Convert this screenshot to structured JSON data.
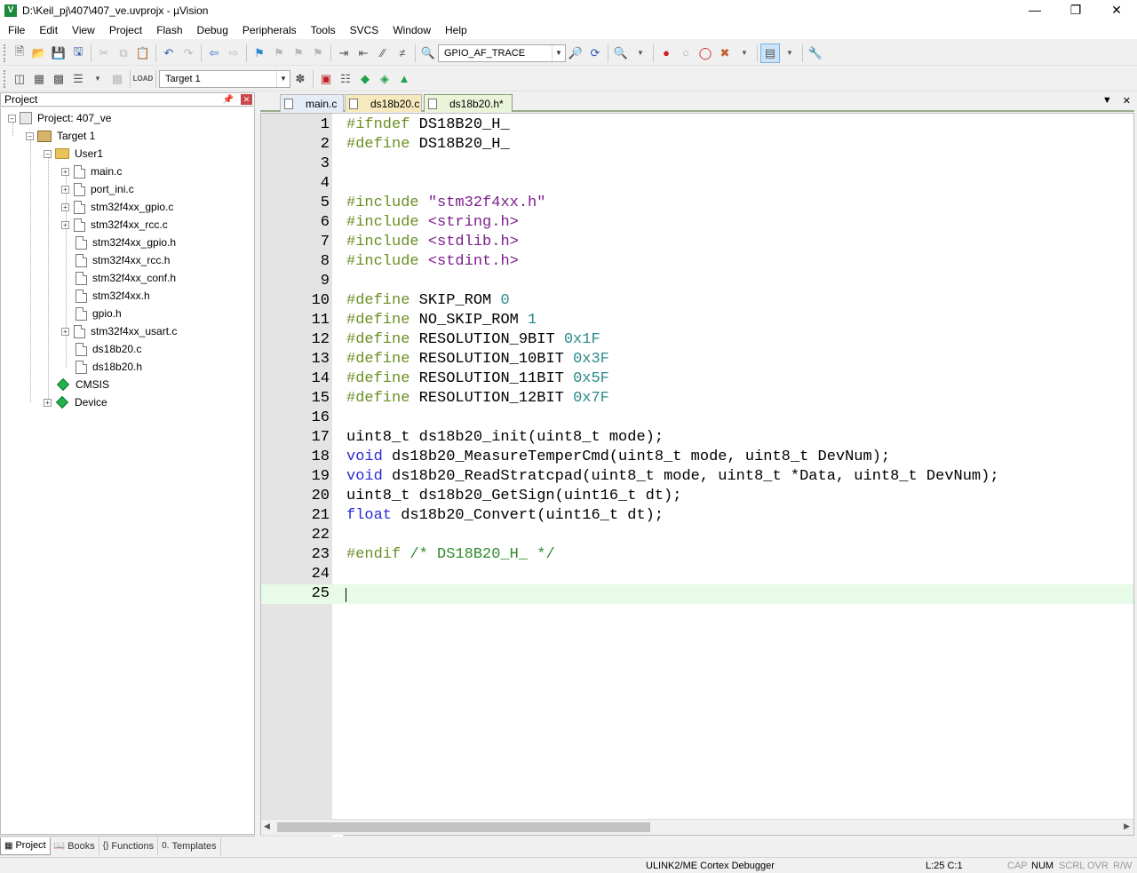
{
  "window": {
    "title": "D:\\Keil_pj\\407\\407_ve.uvprojx - µVision",
    "icon": "V"
  },
  "menu": [
    "File",
    "Edit",
    "View",
    "Project",
    "Flash",
    "Debug",
    "Peripherals",
    "Tools",
    "SVCS",
    "Window",
    "Help"
  ],
  "toolbar": {
    "function_combo": "GPIO_AF_TRACE",
    "target_combo": "Target 1"
  },
  "project_panel": {
    "title": "Project",
    "root": "Project: 407_ve",
    "target": "Target 1",
    "group": "User1",
    "files": [
      "main.c",
      "port_ini.c",
      "stm32f4xx_gpio.c",
      "stm32f4xx_rcc.c",
      "stm32f4xx_gpio.h",
      "stm32f4xx_rcc.h",
      "stm32f4xx_conf.h",
      "stm32f4xx.h",
      "gpio.h",
      "stm32f4xx_usart.c",
      "ds18b20.c",
      "ds18b20.h"
    ],
    "cmsis": "CMSIS",
    "device": "Device"
  },
  "bottom_tabs": [
    "Project",
    "Books",
    "Functions",
    "Templates"
  ],
  "editor_tabs": [
    "main.c",
    "ds18b20.c",
    "ds18b20.h*"
  ],
  "code_lines": [
    "1",
    "2",
    "3",
    "4",
    "5",
    "6",
    "7",
    "8",
    "9",
    "10",
    "11",
    "12",
    "13",
    "14",
    "15",
    "16",
    "17",
    "18",
    "19",
    "20",
    "21",
    "22",
    "23",
    "24",
    "25"
  ],
  "code": {
    "l1a": "#ifndef",
    "l1b": " DS18B20_H_",
    "l2a": "#define",
    "l2b": " DS18B20_H_",
    "l5a": "#include",
    "l5b": " \"stm32f4xx.h\"",
    "l6a": "#include",
    "l6b": " <string.h>",
    "l7a": "#include",
    "l7b": " <stdlib.h>",
    "l8a": "#include",
    "l8b": " <stdint.h>",
    "l10a": "#define",
    "l10b": " SKIP_ROM ",
    "l10c": "0",
    "l11a": "#define",
    "l11b": " NO_SKIP_ROM ",
    "l11c": "1",
    "l12a": "#define",
    "l12b": " RESOLUTION_9BIT ",
    "l12c": "0x1F",
    "l13a": "#define",
    "l13b": " RESOLUTION_10BIT ",
    "l13c": "0x3F",
    "l14a": "#define",
    "l14b": " RESOLUTION_11BIT ",
    "l14c": "0x5F",
    "l15a": "#define",
    "l15b": " RESOLUTION_12BIT ",
    "l15c": "0x7F",
    "l17": "uint8_t ds18b20_init(uint8_t mode);",
    "l18a": "void",
    "l18b": " ds18b20_MeasureTemperCmd(uint8_t mode, uint8_t DevNum);",
    "l19a": "void",
    "l19b": " ds18b20_ReadStratcpad(uint8_t mode, uint8_t *Data, uint8_t DevNum);",
    "l20": "uint8_t ds18b20_GetSign(uint16_t dt);",
    "l21a": "float",
    "l21b": " ds18b20_Convert(uint16_t dt);",
    "l23a": "#endif",
    "l23b": " /* DS18B20_H_ */"
  },
  "status": {
    "debugger": "ULINK2/ME Cortex Debugger",
    "position": "L:25 C:1",
    "cap": "CAP",
    "num": "NUM",
    "scrl": "SCRL",
    "ovr": "OVR",
    "rw": "R/W"
  }
}
